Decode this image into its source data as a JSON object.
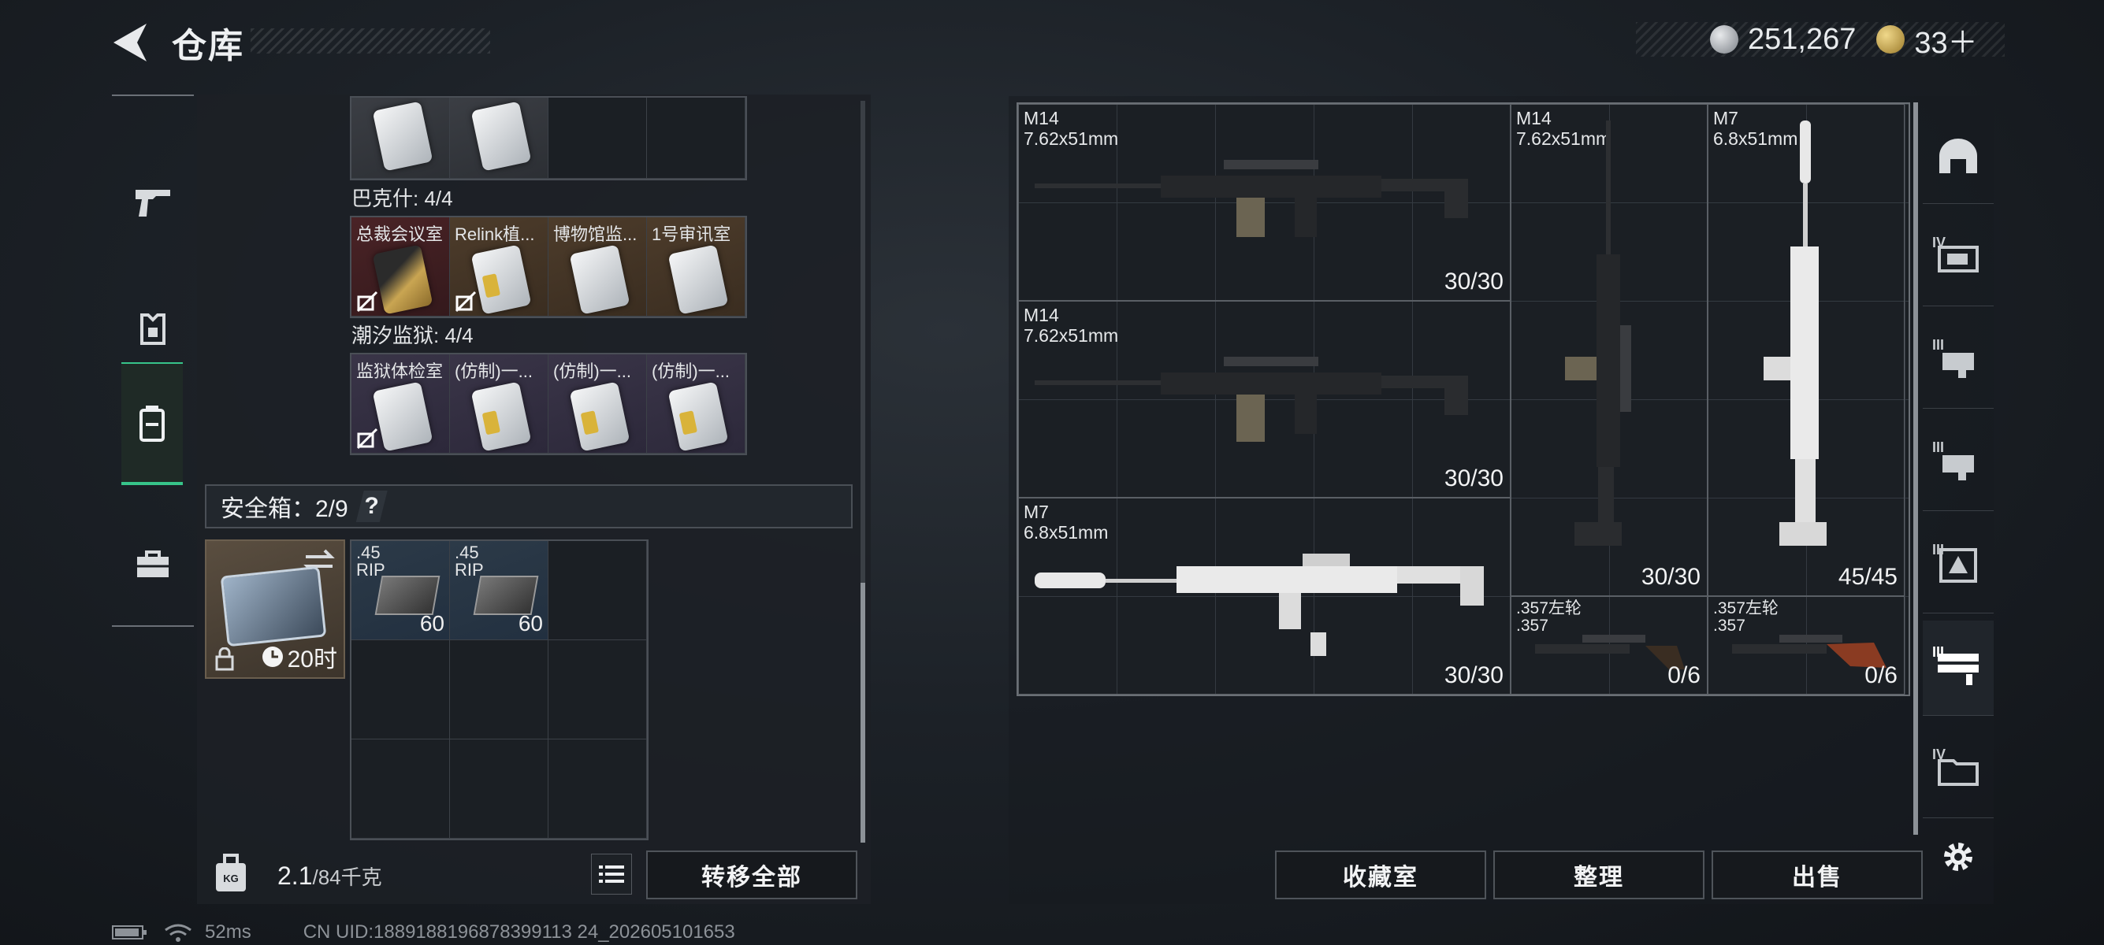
{
  "header": {
    "title": "仓库"
  },
  "currency": {
    "silver": "251,267",
    "gold": "33＋"
  },
  "left_tabs": [
    "weapon-tab",
    "armor-tab",
    "backpack-tab",
    "case-tab"
  ],
  "keycards": {
    "top_row": [
      {
        "label": ""
      },
      {
        "label": ""
      },
      {
        "label": ""
      },
      {
        "label": ""
      }
    ],
    "bakesh": {
      "title": "巴克什: 4/4",
      "items": [
        {
          "label": "总裁会议室"
        },
        {
          "label": "Relink植..."
        },
        {
          "label": "博物馆监..."
        },
        {
          "label": "1号审讯室"
        }
      ]
    },
    "prison": {
      "title": "潮汐监狱: 4/4",
      "items": [
        {
          "label": "监狱体检室"
        },
        {
          "label": "(仿制)一..."
        },
        {
          "label": "(仿制)一..."
        },
        {
          "label": "(仿制)一..."
        }
      ]
    }
  },
  "safe_box": {
    "label": "安全箱：2/9",
    "help": "?",
    "timer": "20时",
    "ammo": [
      {
        "label": ".45\nRIP",
        "qty": "60"
      },
      {
        "label": ".45\nRIP",
        "qty": "60"
      }
    ]
  },
  "footer_left": {
    "weight_value": "2.1",
    "weight_max": "/84千克",
    "transfer_all": "转移全部"
  },
  "weapons": [
    {
      "name": "M14\n7.62x51mm",
      "ammo": "30/30"
    },
    {
      "name": "M14\n7.62x51mm",
      "ammo": "30/30"
    },
    {
      "name": "M7\n6.8x51mm",
      "ammo": "30/30"
    },
    {
      "name": "M14\n7.62x51mm",
      "ammo": "30/30"
    },
    {
      "name": "M7\n6.8x51mm",
      "ammo": "45/45"
    },
    {
      "name": ".357左轮\n.357",
      "ammo": "0/6"
    },
    {
      "name": ".357左轮\n.357",
      "ammo": "0/6"
    }
  ],
  "right_categories": [
    {
      "icon": "helmet-icon",
      "num": ""
    },
    {
      "icon": "rifle-tier4-icon",
      "num": "IV"
    },
    {
      "icon": "rifle-tier3-icon",
      "num": "III"
    },
    {
      "icon": "rifle-tier3b-icon",
      "num": "III"
    },
    {
      "icon": "armor-tier3-icon",
      "num": "III"
    },
    {
      "icon": "weapon-rack-icon",
      "num": "III"
    },
    {
      "icon": "folder-tier4-icon",
      "num": "IV"
    }
  ],
  "footer_right": {
    "collection": "收藏室",
    "sort": "整理",
    "sell": "出售"
  },
  "status": {
    "ping": "52ms",
    "uid": "CN UID:1889188196878399113 24_202605101653"
  }
}
